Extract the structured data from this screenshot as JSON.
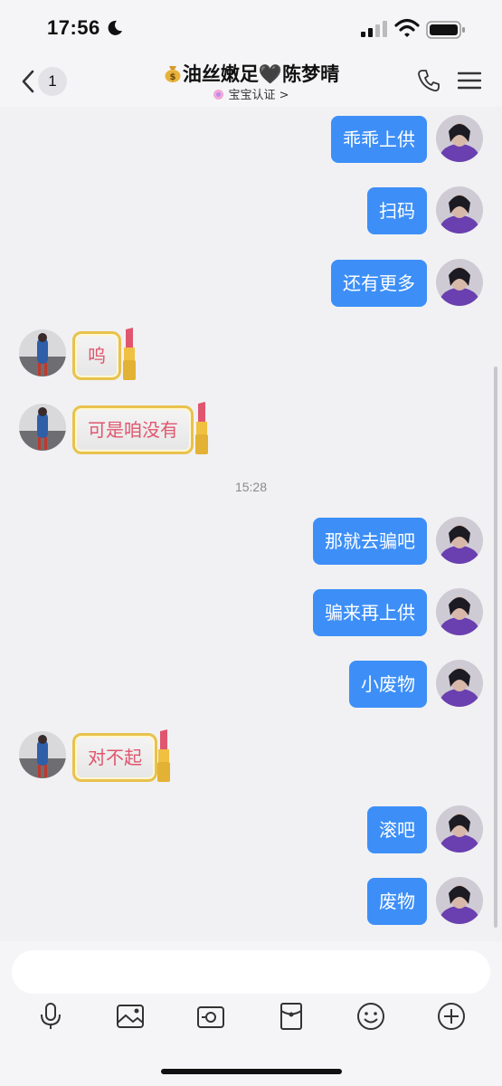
{
  "status_bar": {
    "time": "17:56"
  },
  "nav": {
    "back_badge": "1",
    "title": "油丝嫩足🖤陈梦晴",
    "subtitle": "宝宝认证 >"
  },
  "messages": [
    {
      "side": "me",
      "text": "乖乖上供"
    },
    {
      "side": "me",
      "text": "扫码"
    },
    {
      "side": "me",
      "text": "还有更多"
    },
    {
      "side": "other",
      "text": "呜"
    },
    {
      "side": "other",
      "text": "可是咱没有"
    },
    {
      "side": "me",
      "text": "那就去骗吧"
    },
    {
      "side": "me",
      "text": "骗来再上供"
    },
    {
      "side": "me",
      "text": "小废物"
    },
    {
      "side": "other",
      "text": "对不起"
    },
    {
      "side": "me",
      "text": "滚吧"
    },
    {
      "side": "me",
      "text": "废物"
    }
  ],
  "timestamp": "15:28",
  "input": {
    "placeholder": ""
  },
  "toolbar": [
    "microphone-icon",
    "image-icon",
    "camera-icon",
    "red-packet-icon",
    "emoji-icon",
    "plus-icon"
  ],
  "colors": {
    "my_bubble": "#3d8ff7",
    "other_text": "#e0566e",
    "frame_gold": "#e8c24d"
  }
}
